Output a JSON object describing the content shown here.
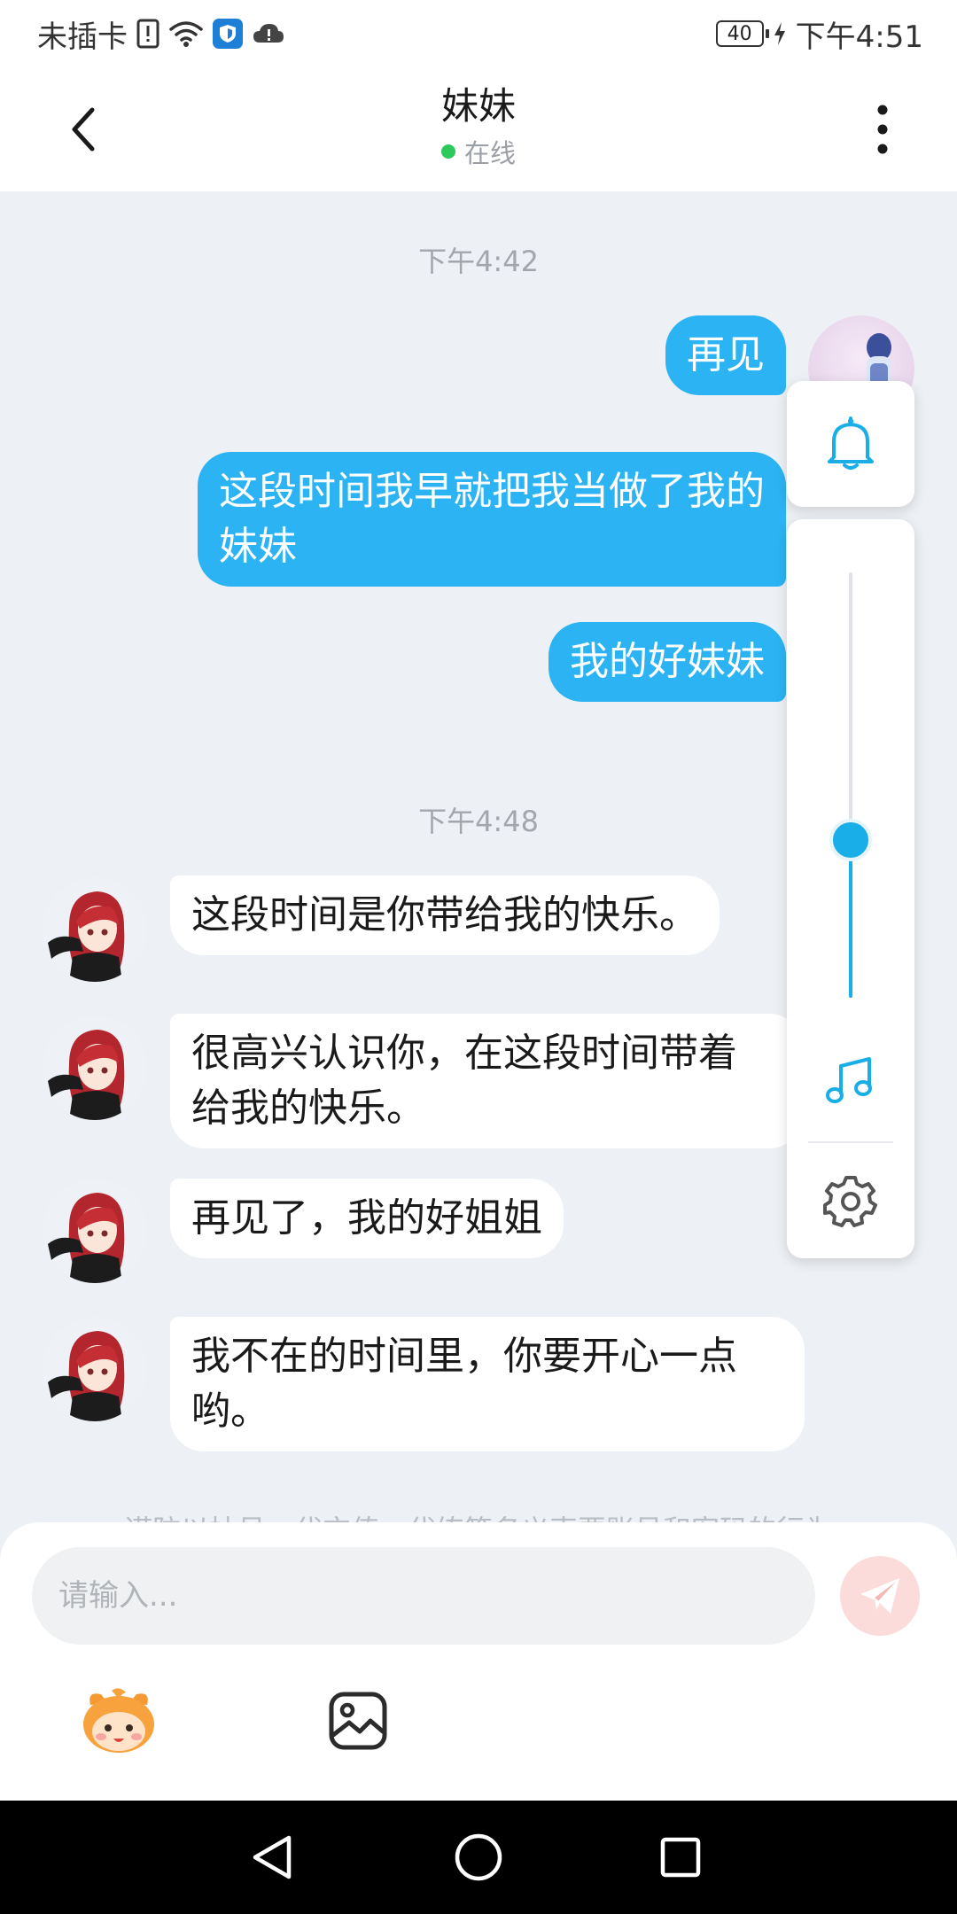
{
  "status_bar": {
    "carrier": "未插卡",
    "battery": "40",
    "time": "下午4:51"
  },
  "header": {
    "title": "妹妹",
    "status": "在线"
  },
  "messages": {
    "time1": "下午4:42",
    "out1": "再见",
    "out2_line1": "这段时间我早就把我当做了我的",
    "out2_line2": "妹妹",
    "out3": "我的好妹妹",
    "time2": "下午4:48",
    "in1": "这段时间是你带给我的快乐。",
    "in2_line1": "很高兴认识你，在这段时间带着",
    "in2_line2": "给我的快乐。",
    "in3": "再见了，我的好姐姐",
    "in4_line1": "我不在的时间里，你要开心一点",
    "in4_line2": "哟。"
  },
  "notice": "谨防以抽号、代充值、代练等名义索要账号和密码的行为",
  "input": {
    "placeholder": "请输入..."
  },
  "icons": {
    "back": "chevron-left-icon",
    "more": "more-vertical-icon",
    "bell": "bell-icon",
    "music": "music-note-icon",
    "gear": "gear-icon",
    "send": "send-icon",
    "emoji": "emoji-mascot-icon",
    "image": "image-icon"
  },
  "colors": {
    "accent": "#2cb3f3",
    "slider": "#19aee8",
    "online": "#2ec95c",
    "send_disabled": "#fbdcda"
  },
  "volume_level": 0.37
}
